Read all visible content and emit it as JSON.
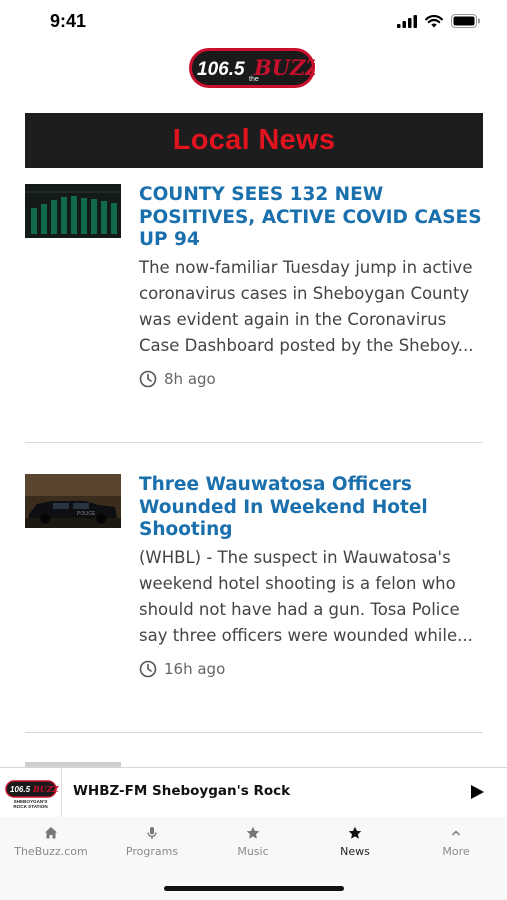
{
  "status_bar": {
    "time": "9:41"
  },
  "header": {
    "logo_number": "106.5",
    "logo_the": "the",
    "logo_word": "BUZZ"
  },
  "section": {
    "title": "Local News"
  },
  "articles": [
    {
      "headline": "COUNTY SEES 132 NEW POSITIVES, ACTIVE COVID CASES UP 94",
      "excerpt": "The now-familiar Tuesday jump in active coronavirus cases in Sheboygan County was evident again in the Coronavirus Case Dashboard posted by the Sheboy...",
      "time": "8h ago",
      "thumb_icon": "bar-chart-thumbnail"
    },
    {
      "headline": "Three Wauwatosa Officers Wounded In Weekend Hotel Shooting",
      "excerpt": "(WHBL) - The suspect in Wauwatosa's weekend hotel shooting is a felon who should not have had a gun. Tosa Police say three officers were wounded while...",
      "time": "16h ago",
      "thumb_icon": "police-car-thumbnail"
    }
  ],
  "player": {
    "station": "WHBZ-FM Sheboygan's Rock",
    "logo_number": "106.5",
    "logo_word": "BUZZ",
    "logo_tagline_1": "SHEBOYGAN'S",
    "logo_tagline_2": "ROCK STATION"
  },
  "tabs": [
    {
      "label": "TheBuzz.com",
      "icon": "home-icon",
      "active": false
    },
    {
      "label": "Programs",
      "icon": "microphone-icon",
      "active": false
    },
    {
      "label": "Music",
      "icon": "star-icon",
      "active": false
    },
    {
      "label": "News",
      "icon": "star-icon",
      "active": true
    },
    {
      "label": "More",
      "icon": "chevron-up-icon",
      "active": false
    }
  ],
  "colors": {
    "headline": "#1a6fad",
    "banner_bg": "#1d1d1d",
    "banner_text": "#e0131f",
    "logo_red": "#c8102e"
  }
}
